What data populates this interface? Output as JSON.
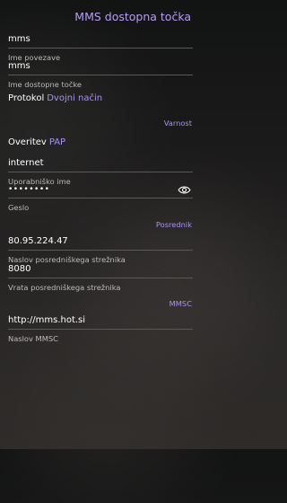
{
  "header": {
    "title": "MMS dostopna točka"
  },
  "fields": {
    "connection_name": {
      "value": "mms",
      "label": "Ime povezave"
    },
    "apn": {
      "value": "mms",
      "label": "Ime dostopne točke"
    },
    "username": {
      "value": "internet",
      "label": "Uporabniško ime"
    },
    "password": {
      "value": "••••••••",
      "label": "Geslo"
    },
    "proxy_address": {
      "value": "80.95.224.47",
      "label": "Naslov posredniškega strežnika"
    },
    "proxy_port": {
      "value": "8080",
      "label": "Vrata posredniškega strežnika"
    },
    "mmsc": {
      "value": "http://mms.hot.si",
      "label": "Naslov MMSC"
    }
  },
  "protocol": {
    "title": "Protokol",
    "value": "Dvojni način"
  },
  "authentication": {
    "title": "Overitev",
    "value": "PAP"
  },
  "sections": {
    "security": "Varnost",
    "proxy": "Posrednik",
    "mmsc": "MMSC"
  },
  "icons": {
    "password_visibility": "eye-icon"
  },
  "colors": {
    "accent": "#b79cf7",
    "text": "#ffffff",
    "secondary": "#bdbab8"
  }
}
